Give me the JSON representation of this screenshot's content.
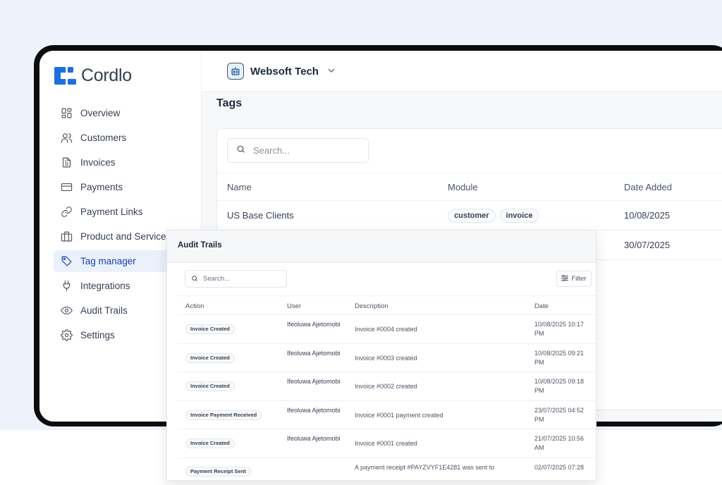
{
  "brand": {
    "name": "Cordlo",
    "color": "#1d6fe0"
  },
  "sidebar": {
    "items": [
      {
        "label": "Overview",
        "icon": "grid-icon"
      },
      {
        "label": "Customers",
        "icon": "users-icon"
      },
      {
        "label": "Invoices",
        "icon": "document-icon"
      },
      {
        "label": "Payments",
        "icon": "credit-card-icon"
      },
      {
        "label": "Payment Links",
        "icon": "link-icon"
      },
      {
        "label": "Product and Services",
        "icon": "briefcase-icon"
      },
      {
        "label": "Tag manager",
        "icon": "tag-icon",
        "active": true
      },
      {
        "label": "Integrations",
        "icon": "plug-icon"
      },
      {
        "label": "Audit Trails",
        "icon": "eye-icon"
      },
      {
        "label": "Settings",
        "icon": "gear-icon"
      }
    ]
  },
  "topbar": {
    "business_name": "Websoft Tech"
  },
  "tags_page": {
    "title": "Tags",
    "search_placeholder": "Search...",
    "columns": {
      "name": "Name",
      "module": "Module",
      "date_added": "Date Added"
    },
    "rows": [
      {
        "name": "US Base Clients",
        "modules": [
          "customer",
          "invoice"
        ],
        "date_added": "10/08/2025"
      },
      {
        "name": "",
        "modules": [],
        "date_added": "30/07/2025"
      }
    ]
  },
  "audit_trails": {
    "title": "Audit Trails",
    "search_placeholder": "Search...",
    "filter_label": "Filter",
    "columns": {
      "action": "Action",
      "user": "User",
      "description": "Description",
      "date": "Date"
    },
    "rows": [
      {
        "action": "Invoice Created",
        "user": "Ifeoluwa Ajetomobi",
        "description": "Invoice #0004 created",
        "date": "10/08/2025 10:17 PM"
      },
      {
        "action": "Invoice Created",
        "user": "Ifeoluwa Ajetomobi",
        "description": "Invoice #0003 created",
        "date": "10/08/2025 09:21 PM"
      },
      {
        "action": "Invoice Created",
        "user": "Ifeoluwa Ajetomobi",
        "description": "Invoice #0002 created",
        "date": "10/08/2025 09:18 PM"
      },
      {
        "action": "Invoice Payment Received",
        "user": "Ifeoluwa Ajetomobi",
        "description": "Invoice #0001 payment created",
        "date": "23/07/2025 04:52 PM"
      },
      {
        "action": "Invoice Created",
        "user": "Ifeoluwa Ajetomobi",
        "description": "Invoice #0001 created",
        "date": "21/07/2025 10:56 AM"
      },
      {
        "action": "Payment Receipt Sent",
        "user": "",
        "description": "A payment receipt #PAYZVYF1E4281 was sent to",
        "date": "02/07/2025 07:28"
      }
    ]
  }
}
